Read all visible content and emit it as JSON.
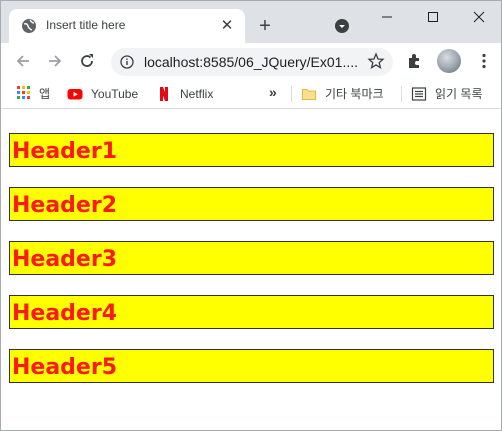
{
  "tab": {
    "title": "Insert title here",
    "close_symbol": "✕"
  },
  "newtab_symbol": "+",
  "address": {
    "host": "localhost:8585/06_JQuery/Ex01....",
    "path": ""
  },
  "bookmarks": {
    "apps_label": "앱",
    "items": [
      {
        "label": "YouTube",
        "icon": "youtube-icon"
      },
      {
        "label": "Netflix",
        "icon": "netflix-icon"
      }
    ],
    "overflow_symbol": "»",
    "other_label": "기타 북마크",
    "reading_label": "읽기 목록"
  },
  "headers": [
    "Header1",
    "Header2",
    "Header3",
    "Header4",
    "Header5"
  ],
  "colors": {
    "header_bg": "#ffff00",
    "header_text": "#ff1a1a",
    "header_border": "#333333"
  }
}
